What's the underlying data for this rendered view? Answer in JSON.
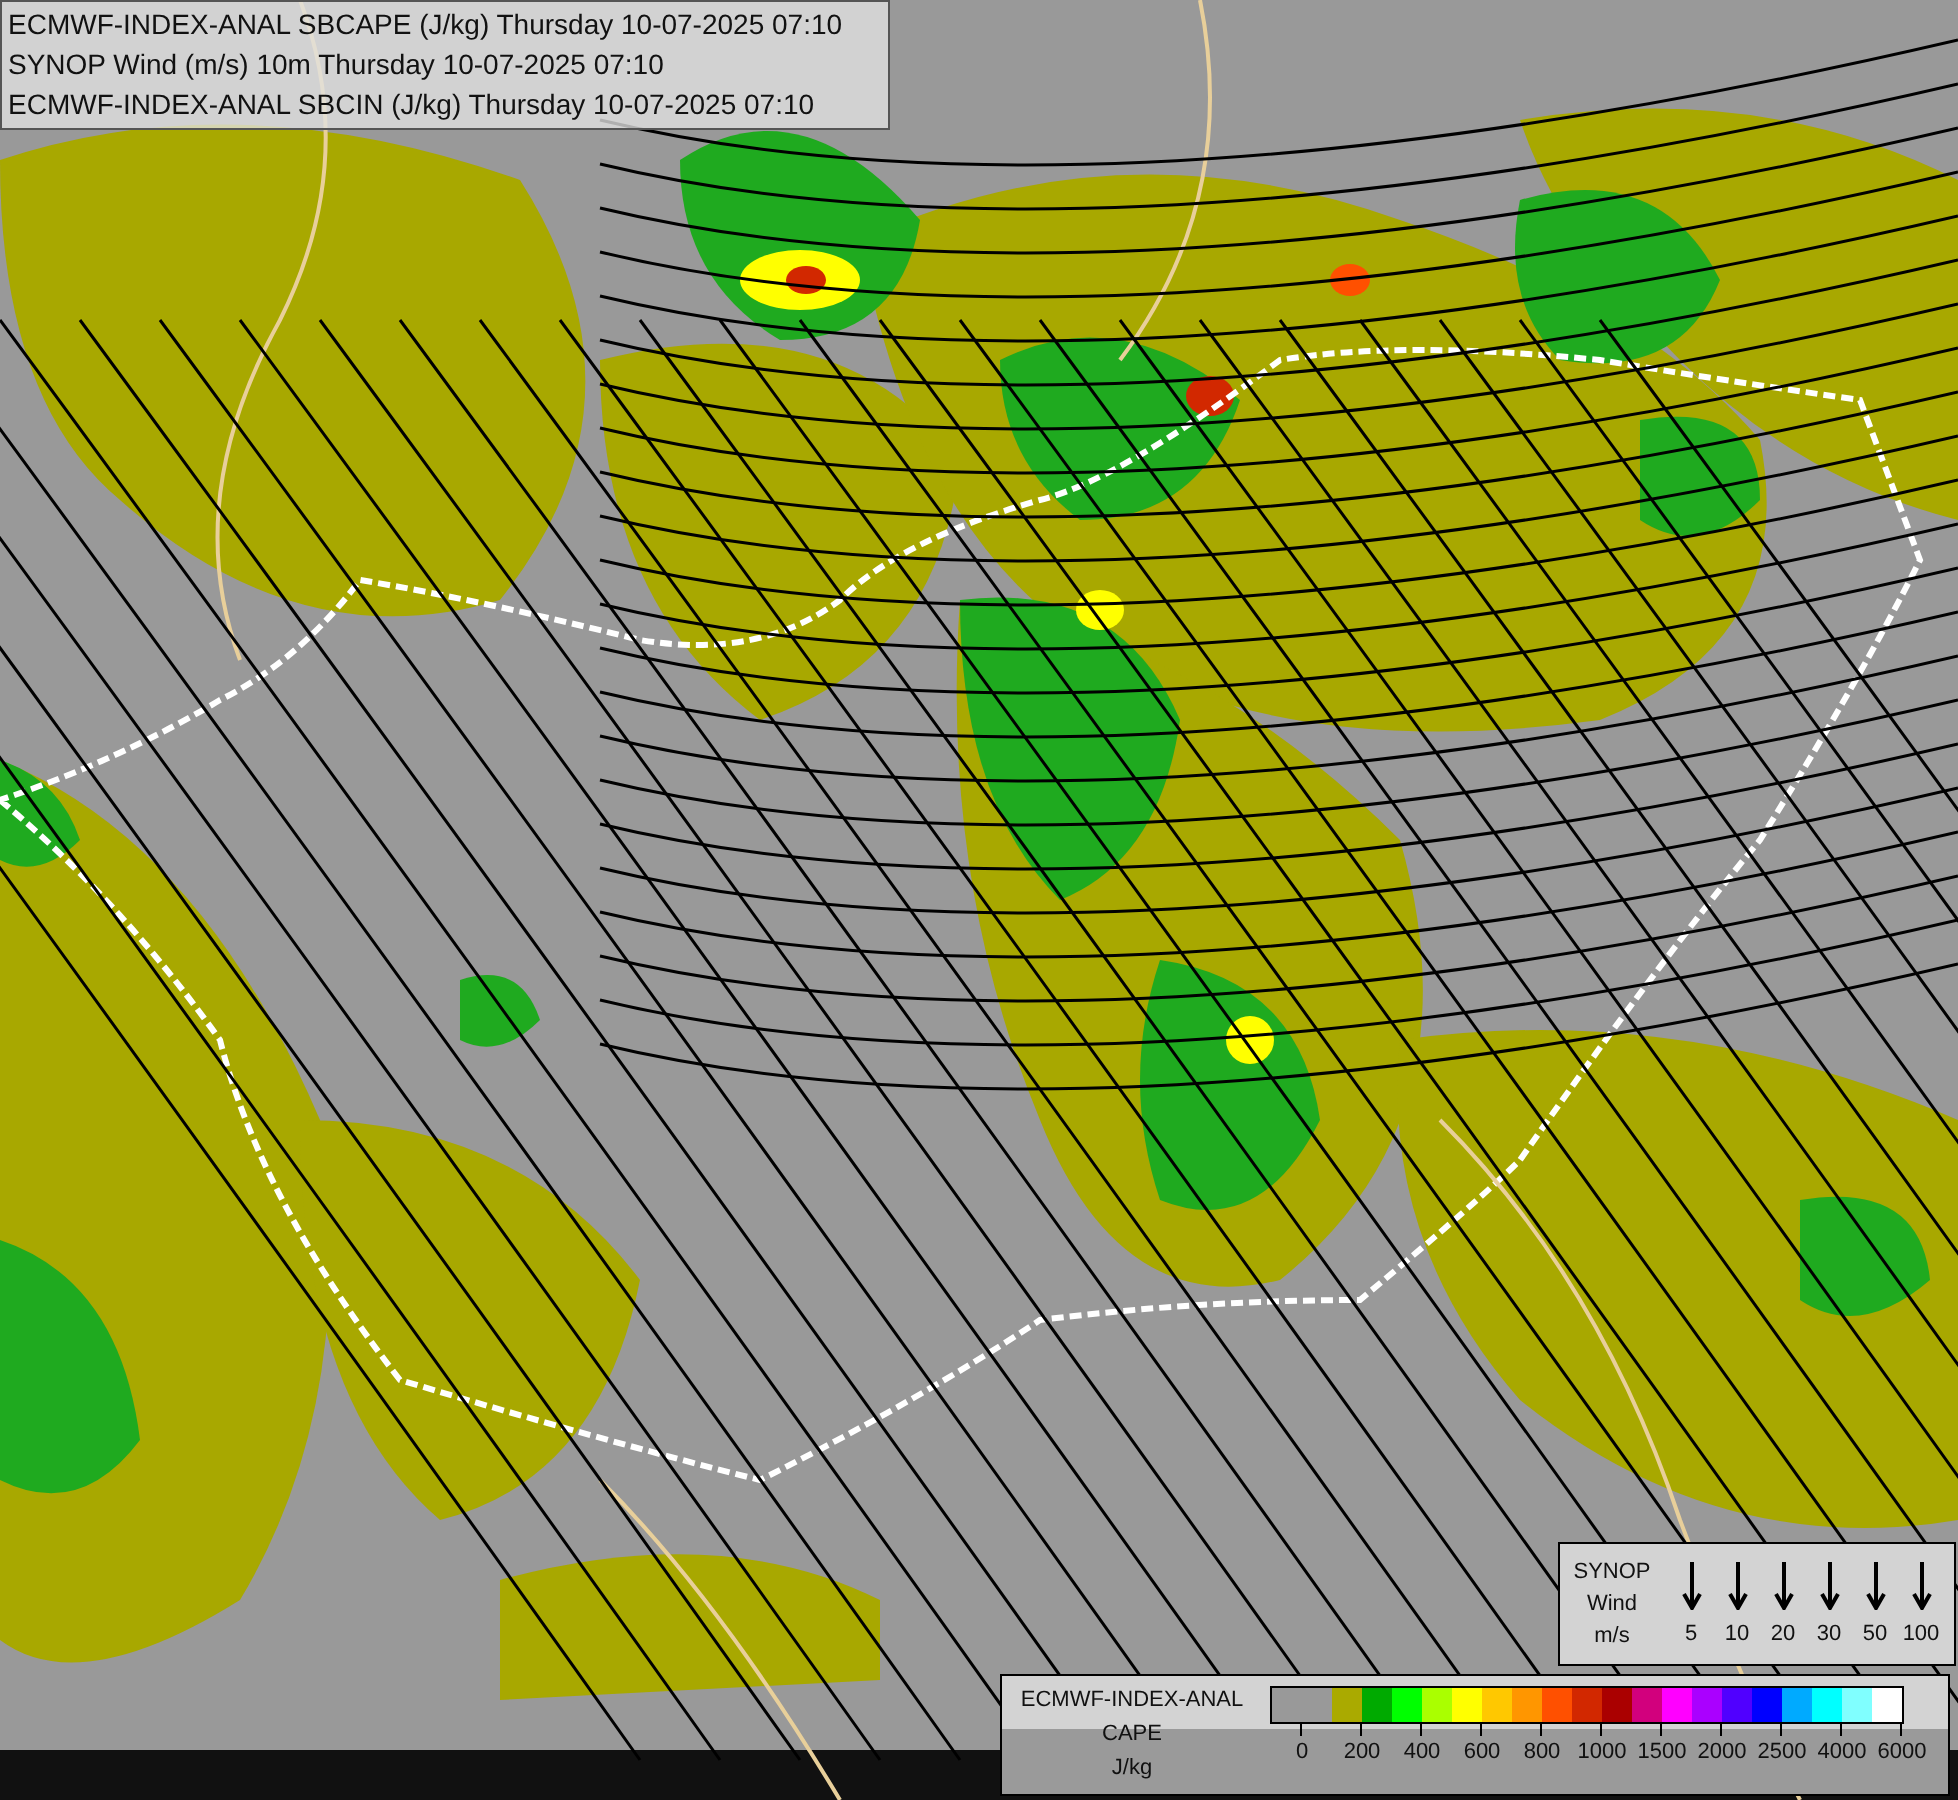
{
  "header": {
    "lines": [
      "ECMWF-INDEX-ANAL SBCAPE (J/kg) Thursday 10-07-2025 07:10",
      "SYNOP Wind (m/s) 10m Thursday 10-07-2025 07:10",
      "ECMWF-INDEX-ANAL SBCIN (J/kg) Thursday 10-07-2025 07:10"
    ]
  },
  "wind_legend": {
    "title_lines": [
      "SYNOP",
      "Wind",
      "m/s"
    ],
    "speeds": [
      "5",
      "10",
      "20",
      "30",
      "50",
      "100"
    ]
  },
  "cape_legend": {
    "title_lines": [
      "ECMWF-INDEX-ANAL",
      "CAPE",
      "J/kg"
    ],
    "swatches": [
      {
        "color": "#999999"
      },
      {
        "color": "#999999"
      },
      {
        "color": "#aaaa00"
      },
      {
        "color": "#00aa00"
      },
      {
        "color": "#00ff00"
      },
      {
        "color": "#aaff00"
      },
      {
        "color": "#ffff00"
      },
      {
        "color": "#ffc800"
      },
      {
        "color": "#ff9600"
      },
      {
        "color": "#ff5000"
      },
      {
        "color": "#d22800"
      },
      {
        "color": "#aa0000"
      },
      {
        "color": "#d2007d"
      },
      {
        "color": "#ff00ff"
      },
      {
        "color": "#aa00ff"
      },
      {
        "color": "#5000ff"
      },
      {
        "color": "#0000ff"
      },
      {
        "color": "#00aaff"
      },
      {
        "color": "#00ffff"
      },
      {
        "color": "#80ffff"
      },
      {
        "color": "#ffffff"
      }
    ],
    "ticks": [
      "0",
      "200",
      "400",
      "600",
      "800",
      "1000",
      "1500",
      "2000",
      "2500",
      "4000",
      "6000"
    ]
  }
}
